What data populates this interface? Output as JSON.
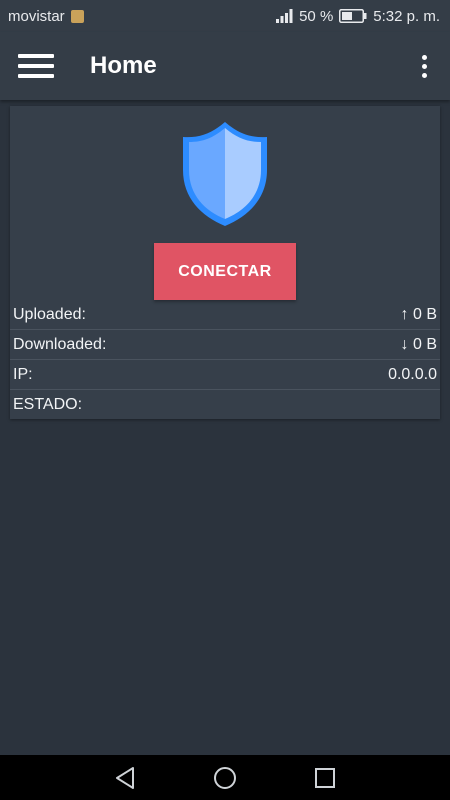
{
  "status_bar": {
    "carrier": "movistar",
    "battery_percent": "50 %",
    "time": "5:32 p. m."
  },
  "app_bar": {
    "title": "Home"
  },
  "card": {
    "connect_label": "CONECTAR",
    "rows": [
      {
        "label": "Uploaded:",
        "value": "↑ 0 B"
      },
      {
        "label": "Downloaded:",
        "value": "↓ 0 B"
      },
      {
        "label": "IP:",
        "value": "0.0.0.0"
      },
      {
        "label": "ESTADO:",
        "value": ""
      }
    ]
  },
  "colors": {
    "background": "#2b333d",
    "toolbar": "#343d47",
    "card": "#363f4a",
    "accent_button": "#e05464",
    "shield_blue": "#2d8cff",
    "shield_light": "#a9ccff"
  },
  "icons": [
    "sim-icon",
    "signal-icon",
    "battery-icon",
    "menu-icon",
    "more-vert-icon",
    "shield-icon",
    "nav-back-icon",
    "nav-home-icon",
    "nav-recents-icon"
  ]
}
